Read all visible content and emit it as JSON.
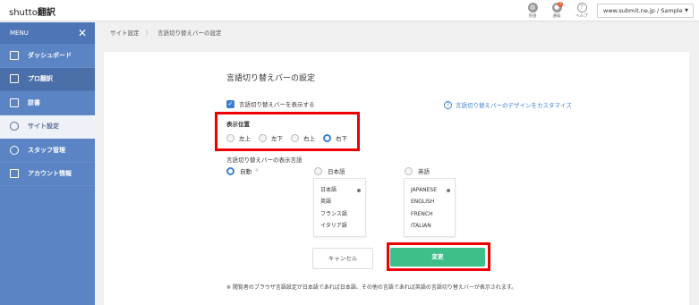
{
  "app": {
    "logo_text": "shutto",
    "logo_suffix": "翻訳"
  },
  "header": {
    "icons": [
      {
        "name": "language-icon",
        "label": "英語"
      },
      {
        "name": "notification-icon",
        "label": "通知",
        "badge": "1"
      },
      {
        "name": "help-icon",
        "label": "ヘルプ"
      }
    ],
    "site_selector": "www.submit.ne.jp / Sample"
  },
  "sidebar": {
    "menu_label": "MENU",
    "close_glyph": "✕",
    "items": [
      {
        "label": "ダッシュボード"
      },
      {
        "label": "プロ翻訳"
      },
      {
        "label": "辞書"
      },
      {
        "label": "サイト設定"
      },
      {
        "label": "スタッフ管理"
      },
      {
        "label": "アカウント情報"
      }
    ],
    "selected_index": 3
  },
  "breadcrumb": {
    "items": [
      "サイト設定",
      "言語切り替えバーの設定"
    ],
    "separator": "〉"
  },
  "main": {
    "title": "言語切り替えバーの設定",
    "show_bar_checkbox": {
      "label": "言語切り替えバーを表示する",
      "checked": true
    },
    "customize_link": "言語切り替えバーのデザインをカスタマイズ",
    "position": {
      "label": "表示位置",
      "options": [
        "左上",
        "左下",
        "右上",
        "右下"
      ],
      "selected": "右下"
    },
    "display_language": {
      "label": "言語切り替えバーの表示言語",
      "options": [
        {
          "label": "自動",
          "mark": "※",
          "selected": true
        },
        {
          "label": "日本語",
          "selected": false
        },
        {
          "label": "英語",
          "selected": false
        }
      ],
      "japanese_list": [
        "日本語",
        "英語",
        "フランス語",
        "イタリア語"
      ],
      "english_list": [
        "JAPANESE",
        "ENGLISH",
        "FRENCH",
        "ITALIAN"
      ]
    },
    "cancel_label": "キャンセル",
    "save_label": "変更",
    "footnote": "※ 閲覧者のブラウザ言語設定が日本語であれば日本語、その他の言語であれば英語の言語切り替えバーが表示されます。"
  },
  "colors": {
    "sidebar": "#5b84c4",
    "accent": "#3c7fd0",
    "save_button": "#3dbf8a",
    "highlight_box": "#e00000"
  }
}
